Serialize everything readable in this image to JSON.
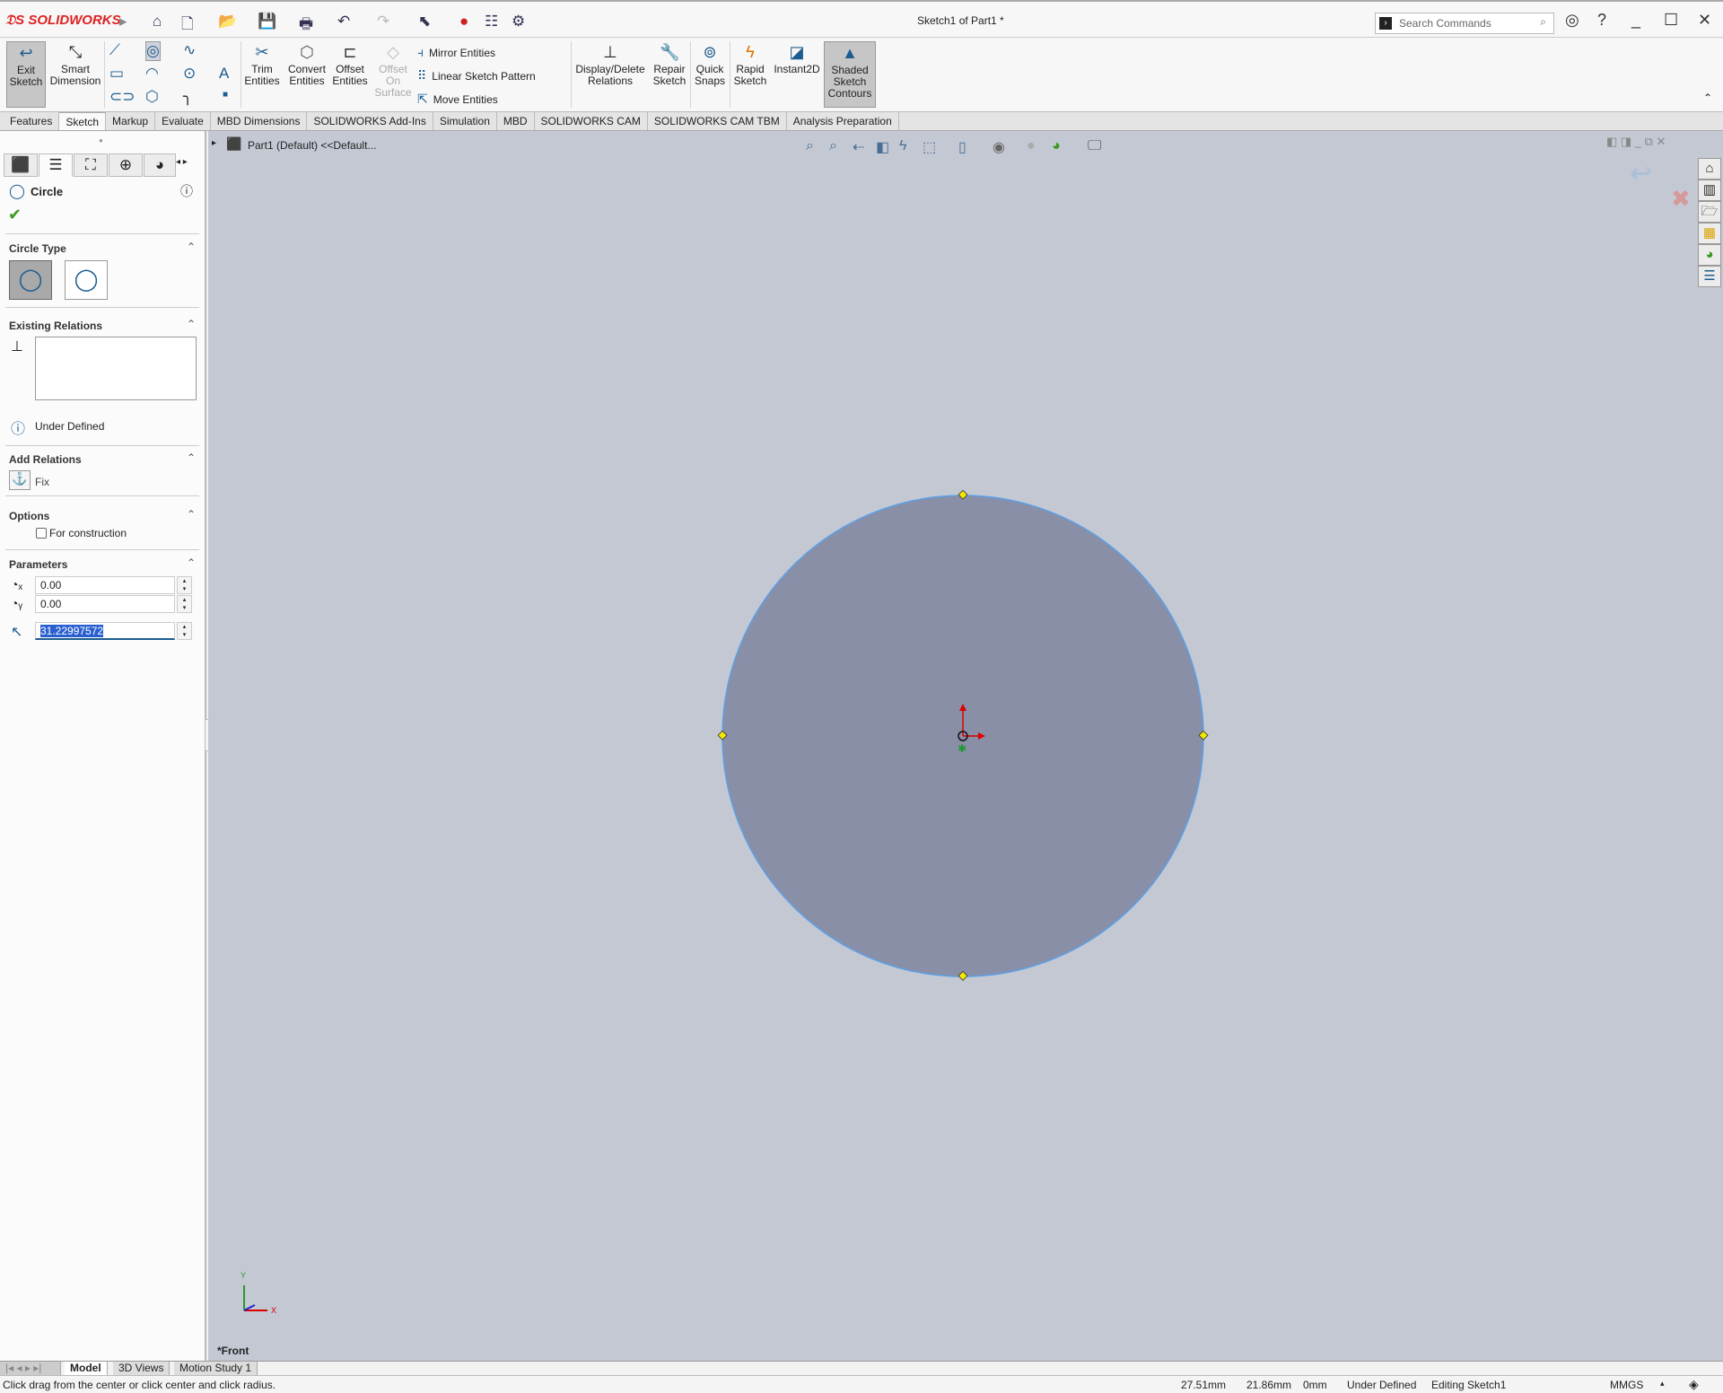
{
  "app": {
    "brand": "SOLIDWORKS",
    "window_title": "Sketch1 of Part1 *",
    "search_placeholder": "Search Commands",
    "accent": "#d22222"
  },
  "ribbon": {
    "exit_sketch": "Exit Sketch",
    "smart_dimension": "Smart Dimension",
    "trim": "Trim Entities",
    "convert": "Convert Entities",
    "offset": "Offset Entities",
    "offset_surface": "Offset On Surface",
    "mirror": "Mirror Entities",
    "linear_pattern": "Linear Sketch Pattern",
    "move": "Move Entities",
    "display_delete": "Display/Delete Relations",
    "repair": "Repair Sketch",
    "quick_snaps": "Quick Snaps",
    "rapid": "Rapid Sketch",
    "instant2d": "Instant2D",
    "shaded": "Shaded Sketch Contours"
  },
  "tabs": [
    "Features",
    "Sketch",
    "Markup",
    "Evaluate",
    "MBD Dimensions",
    "SOLIDWORKS Add-Ins",
    "Simulation",
    "MBD",
    "SOLIDWORKS CAM",
    "SOLIDWORKS CAM TBM",
    "Analysis Preparation"
  ],
  "active_tab": "Sketch",
  "panel": {
    "title": "Circle",
    "circle_type": "Circle Type",
    "existing_relations": "Existing Relations",
    "status": "Under Defined",
    "add_relations": "Add Relations",
    "fix": "Fix",
    "options": "Options",
    "for_construction": "For construction",
    "for_construction_checked": false,
    "parameters": "Parameters",
    "cx": "0.00",
    "cy": "0.00",
    "radius": "31.22997572"
  },
  "viewport": {
    "tree_item": "Part1 (Default) <<Default...",
    "view_name": "*Front",
    "background": "#c4c8d3",
    "circle_fill": "#8a8fa8",
    "circle_stroke": "#5aa0e8"
  },
  "bottom_tabs": [
    "Model",
    "3D Views",
    "Motion Study 1"
  ],
  "status": {
    "hint": "Click drag from the center or click center and click radius.",
    "x": "27.51mm",
    "y": "21.86mm",
    "z": "0mm",
    "state": "Under Defined",
    "editing": "Editing Sketch1",
    "units": "MMGS"
  }
}
